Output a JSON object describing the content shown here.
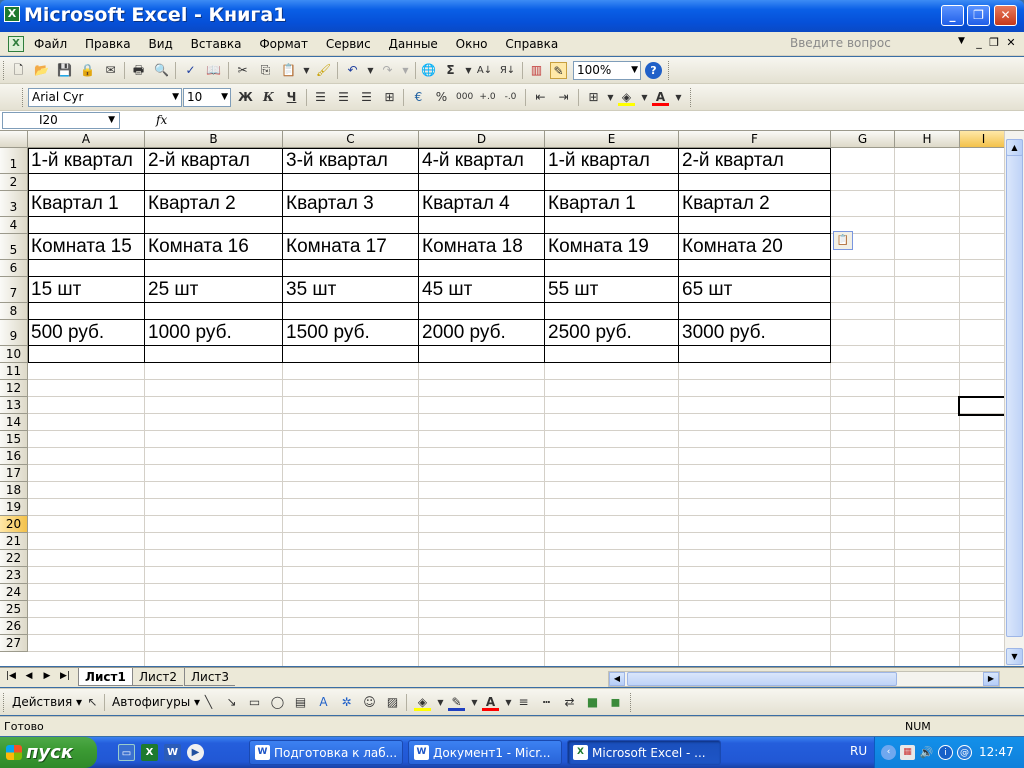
{
  "window": {
    "title": "Microsoft Excel - Книга1",
    "app_icon": "excel-icon"
  },
  "menu": {
    "items": [
      "Файл",
      "Правка",
      "Вид",
      "Вставка",
      "Формат",
      "Сервис",
      "Данные",
      "Окно",
      "Справка"
    ],
    "help_placeholder": "Введите вопрос"
  },
  "toolbar": {
    "zoom": "100%",
    "font_name": "Arial Cyr",
    "font_size": "10",
    "bold": "Ж",
    "italic": "К",
    "underline": "Ч",
    "sigma": "Σ",
    "percent": "%",
    "fill_color": "#ffff00",
    "font_color": "#ff0000"
  },
  "formula_bar": {
    "name_box": "I20",
    "fx": "fx",
    "formula": ""
  },
  "columns": [
    "A",
    "B",
    "C",
    "D",
    "E",
    "F",
    "G",
    "H",
    "I"
  ],
  "rows": [
    "1",
    "2",
    "3",
    "4",
    "5",
    "6",
    "7",
    "8",
    "9",
    "10",
    "11",
    "12",
    "13",
    "14",
    "15",
    "16",
    "17",
    "18",
    "19",
    "20",
    "21",
    "22",
    "23",
    "24",
    "25",
    "26",
    "27"
  ],
  "cells": {
    "r1": [
      "1-й квартал",
      "2-й квартал",
      "3-й квартал",
      "4-й квартал",
      "1-й квартал",
      "2-й квартал"
    ],
    "r3": [
      "Квартал 1",
      "Квартал 2",
      "Квартал 3",
      "Квартал 4",
      "Квартал 1",
      "Квартал 2"
    ],
    "r5": [
      "Комната 15",
      "Комната 16",
      "Комната 17",
      "Комната 18",
      "Комната 19",
      "Комната 20"
    ],
    "r7": [
      "15 шт",
      "25 шт",
      "35 шт",
      "45 шт",
      "55 шт",
      "65 шт"
    ],
    "r9": [
      "500 руб.",
      "1000 руб.",
      "1500 руб.",
      "2000 руб.",
      "2500 руб.",
      "3000 руб."
    ]
  },
  "sheets": [
    "Лист1",
    "Лист2",
    "Лист3"
  ],
  "drawing": {
    "actions": "Действия",
    "autoshapes": "Автофигуры"
  },
  "status": {
    "left": "Готово",
    "num": "NUM"
  },
  "taskbar": {
    "start": "пуск",
    "tasks": [
      "Подготовка к лаб...",
      "Документ1 - Micr...",
      "Microsoft Excel - ..."
    ],
    "lang": "RU",
    "clock": "12:47"
  }
}
